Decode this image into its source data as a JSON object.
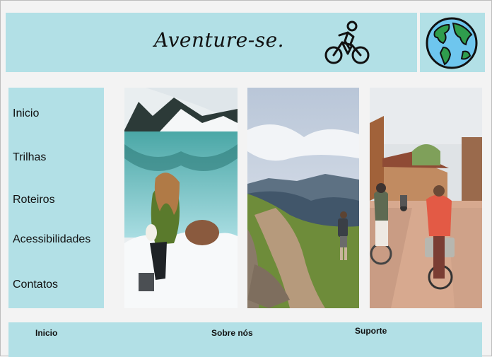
{
  "header": {
    "brand": "Aventure-se.",
    "bike_icon": "cyclist-icon",
    "globe_icon": "globe-icon"
  },
  "sidebar": {
    "items": [
      {
        "label": "Inicio"
      },
      {
        "label": "Trilhas"
      },
      {
        "label": "Roteiros"
      },
      {
        "label": "Acessibilidades"
      },
      {
        "label": "Contatos"
      }
    ]
  },
  "gallery": [
    {
      "subject": "woman sitting on snowy rock by mountain lake"
    },
    {
      "subject": "hiker on mountain trail"
    },
    {
      "subject": "cyclists on village street"
    }
  ],
  "footer": {
    "links": [
      {
        "label": "Inicio"
      },
      {
        "label": "Sobre nós"
      },
      {
        "label": "Suporte"
      }
    ]
  },
  "colors": {
    "panel": "#b2e0e6",
    "background": "#f3f3f3"
  }
}
